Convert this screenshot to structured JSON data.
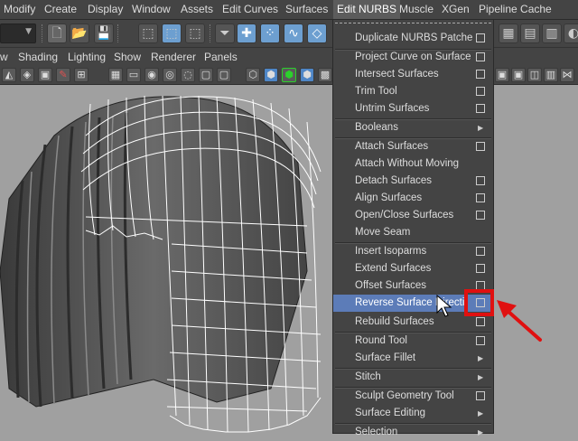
{
  "menubar": {
    "items": [
      "Modify",
      "Create",
      "Display",
      "Window",
      "Assets",
      "Edit Curves",
      "Surfaces",
      "Edit NURBS",
      "Muscle",
      "XGen",
      "Pipeline Cache"
    ],
    "active": "Edit NURBS"
  },
  "panelbar": {
    "items": [
      "w",
      "Shading",
      "Lighting",
      "Show",
      "Renderer",
      "Panels"
    ]
  },
  "edit_nurbs_menu": {
    "items": [
      {
        "label": "Duplicate NURBS Patches",
        "option": true
      },
      {
        "label": "Project Curve on Surface",
        "option": true
      },
      {
        "label": "Intersect Surfaces",
        "option": true
      },
      {
        "label": "Trim Tool",
        "option": true
      },
      {
        "label": "Untrim Surfaces",
        "option": true
      },
      {
        "label": "Booleans",
        "submenu": true
      },
      {
        "label": "Attach Surfaces",
        "option": true
      },
      {
        "label": "Attach Without Moving"
      },
      {
        "label": "Detach Surfaces",
        "option": true
      },
      {
        "label": "Align Surfaces",
        "option": true
      },
      {
        "label": "Open/Close Surfaces",
        "option": true
      },
      {
        "label": "Move Seam"
      },
      {
        "label": "Insert Isoparms",
        "option": true
      },
      {
        "label": "Extend Surfaces",
        "option": true
      },
      {
        "label": "Offset Surfaces",
        "option": true
      },
      {
        "label": "Reverse Surface Direction",
        "option": true,
        "highlighted": true
      },
      {
        "label": "Rebuild Surfaces",
        "option": true
      },
      {
        "label": "Round Tool",
        "option": true
      },
      {
        "label": "Surface Fillet",
        "submenu": true
      },
      {
        "label": "Stitch",
        "submenu": true
      },
      {
        "label": "Sculpt Geometry Tool",
        "option": true
      },
      {
        "label": "Surface Editing",
        "submenu": true
      },
      {
        "label": "Selection",
        "submenu": true
      }
    ]
  },
  "colors": {
    "highlight": "#5c7cb8",
    "annotation": "#e01010",
    "background": "#a0a0a0"
  }
}
